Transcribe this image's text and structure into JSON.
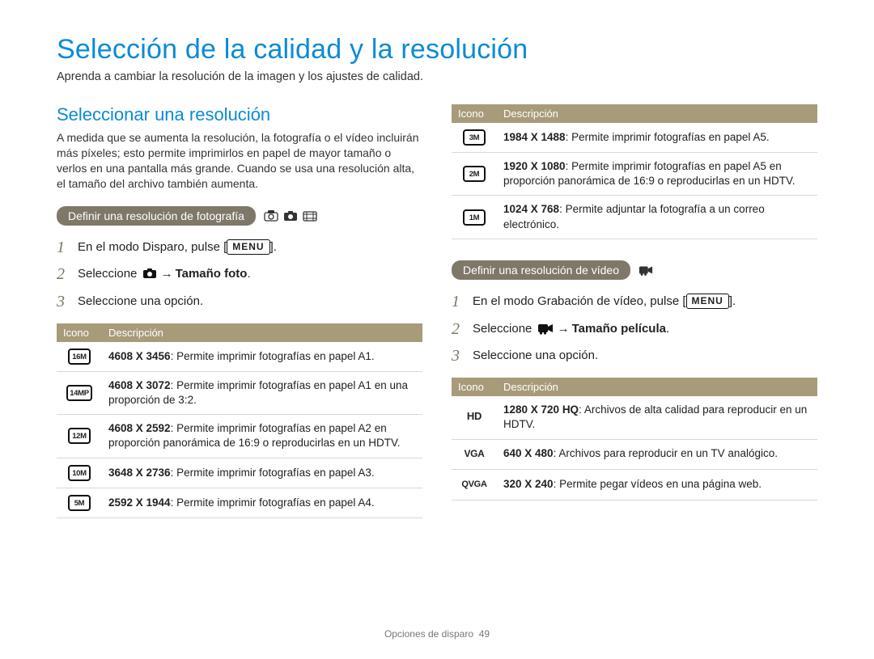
{
  "title": "Selección de la calidad y la resolución",
  "intro": "Aprenda a cambiar la resolución de la imagen y los ajustes de calidad.",
  "section": {
    "title": "Seleccionar una resolución",
    "intro": "A medida que se aumenta la resolución, la fotografía o el vídeo incluirán más píxeles; esto permite imprimirlos en papel de mayor tamaño o verlos en una pantalla más grande. Cuando se usa una resolución alta, el tamaño del archivo también aumenta."
  },
  "photo": {
    "pill": "Definir una resolución de fotografía",
    "step1_prefix": "En el modo Disparo, pulse [",
    "step1_suffix": "].",
    "menu_label": "MENU",
    "step2_prefix": "Seleccione ",
    "step2_arrow": "→",
    "step2_bold": "Tamaño foto",
    "step2_suffix": ".",
    "step3": "Seleccione una opción.",
    "table_headers": {
      "icon": "Icono",
      "desc": "Descripción"
    },
    "rows_left": [
      {
        "icon": "16M",
        "bold": "4608 X 3456",
        "text": ": Permite imprimir fotografías en papel A1."
      },
      {
        "icon": "14MP",
        "bold": "4608 X 3072",
        "text": ": Permite imprimir fotografías en papel A1 en una proporción de 3:2."
      },
      {
        "icon": "12M",
        "bold": "4608 X 2592",
        "text": ": Permite imprimir fotografías en papel A2 en proporción panorámica de 16:9 o reproducirlas en un HDTV."
      },
      {
        "icon": "10M",
        "bold": "3648 X 2736",
        "text": ": Permite imprimir fotografías en papel A3."
      },
      {
        "icon": "5M",
        "bold": "2592 X 1944",
        "text": ": Permite imprimir fotografías en papel A4."
      }
    ],
    "rows_right": [
      {
        "icon": "3M",
        "bold": "1984 X 1488",
        "text": ": Permite imprimir fotografías en papel A5."
      },
      {
        "icon": "2M",
        "bold": "1920 X 1080",
        "text": ": Permite imprimir fotografías en papel A5 en proporción panorámica de 16:9 o reproducirlas en un HDTV."
      },
      {
        "icon": "1M",
        "bold": "1024 X 768",
        "text": ": Permite adjuntar la fotografía a un correo electrónico."
      }
    ]
  },
  "video": {
    "pill": "Definir una resolución de vídeo",
    "step1_prefix": "En el modo Grabación de vídeo, pulse [",
    "step1_suffix": "].",
    "menu_label": "MENU",
    "step2_prefix": "Seleccione ",
    "step2_arrow": "→",
    "step2_bold": "Tamaño película",
    "step2_suffix": ".",
    "step3": "Seleccione una opción.",
    "table_headers": {
      "icon": "Icono",
      "desc": "Descripción"
    },
    "rows": [
      {
        "icon": "HD",
        "bold": "1280 X 720 HQ",
        "text": ": Archivos de alta calidad para reproducir en un HDTV."
      },
      {
        "icon": "VGA",
        "bold": "640 X 480",
        "text": ": Archivos para reproducir en un TV analógico."
      },
      {
        "icon": "QVGA",
        "bold": "320 X 240",
        "text": ": Permite pegar vídeos en una página web."
      }
    ]
  },
  "footer": {
    "section": "Opciones de disparo",
    "page": "49"
  }
}
